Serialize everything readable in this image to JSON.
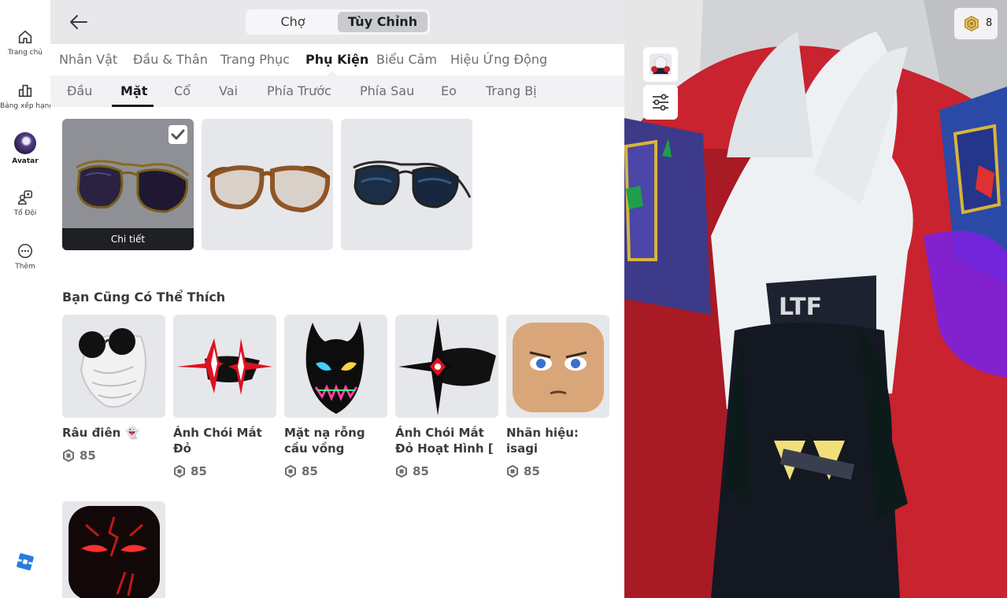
{
  "nav": {
    "items": [
      {
        "id": "home",
        "label": "Trang chủ",
        "icon": "home-icon"
      },
      {
        "id": "leaderboard",
        "label": "Bảng xếp hạng",
        "icon": "chart-icon"
      },
      {
        "id": "avatar",
        "label": "Avatar",
        "icon": "avatar-thumbnail",
        "active": true
      },
      {
        "id": "groups",
        "label": "Tổ Đội",
        "icon": "groups-icon"
      },
      {
        "id": "more",
        "label": "Thêm",
        "icon": "more-icon"
      }
    ]
  },
  "header": {
    "segments": [
      "Chợ",
      "Tùy Chỉnh"
    ],
    "active_segment": 1
  },
  "tabs_primary": [
    {
      "label": "Nhân Vật"
    },
    {
      "label": "Đầu & Thân"
    },
    {
      "label": "Trang Phục"
    },
    {
      "label": "Phụ Kiện",
      "active": true
    },
    {
      "label": "Biểu Cảm"
    },
    {
      "label": "Hiệu Ứng Động"
    }
  ],
  "tabs_secondary": [
    {
      "label": "Đầu"
    },
    {
      "label": "Mặt",
      "active": true
    },
    {
      "label": "Cổ"
    },
    {
      "label": "Vai"
    },
    {
      "label": "Phía Trước"
    },
    {
      "label": "Phía Sau"
    },
    {
      "label": "Eo"
    },
    {
      "label": "Trang Bị"
    }
  ],
  "owned_items": [
    {
      "kind": "aviator-purple-sunglasses",
      "selected": true,
      "detail_label": "Chi tiết"
    },
    {
      "kind": "brown-glasses",
      "selected": false
    },
    {
      "kind": "aviator-blue-sunglasses",
      "selected": false
    }
  ],
  "recommendations": {
    "title": "Bạn Cũng Có Thể Thích",
    "items": [
      {
        "name": "Râu điên 👻",
        "price": "85"
      },
      {
        "name": "Ánh Chói Mắt Đỏ",
        "price": "85"
      },
      {
        "name": "Mặt nạ rỗng cầu vồng",
        "price": "85"
      },
      {
        "name": "Ánh Chói Mắt Đỏ Hoạt Hình [",
        "price": "85"
      },
      {
        "name": "Nhãn hiệu: isagi",
        "price": "85"
      },
      {
        "name": "",
        "price": ""
      }
    ]
  },
  "currency": {
    "robux_balance": "8"
  },
  "colors": {
    "accent": "#1a1c1f",
    "selected_tab_bg": "#c9cbd1",
    "robux_gold": "#c9a227"
  }
}
